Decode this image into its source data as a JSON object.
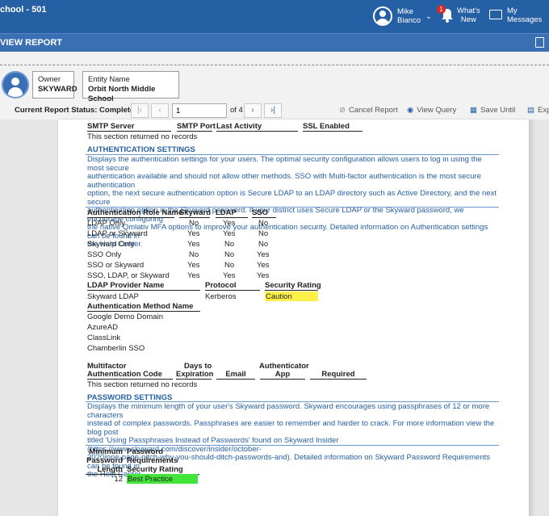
{
  "header": {
    "app_title": "chool - 501",
    "user_first": "Mike",
    "user_last": "Bianco",
    "notif_count": "1",
    "whats_new_1": "What's",
    "whats_new_2": "New",
    "my_messages_1": "My",
    "my_messages_2": "Messages",
    "subbar_title": "VIEW REPORT"
  },
  "owner": {
    "label": "Owner",
    "value": "SKYWARD"
  },
  "entity": {
    "label": "Entity Name",
    "value": "Orbit North Middle School"
  },
  "status": {
    "text": "Current Report Status: Completed",
    "page_value": "1",
    "of_label": "of 4",
    "cancel": "Cancel Report",
    "view_query": "View Query",
    "save_until": "Save Until",
    "export": "Exp"
  },
  "smtp": {
    "cols": [
      "SMTP Server",
      "SMTP Port",
      "Last Activity",
      "SSL Enabled"
    ],
    "empty": "This section returned no records"
  },
  "auth": {
    "title": "AUTHENTICATION SETTINGS",
    "desc": [
      "Displays the authentication settings for your users. The optimal security configuration allows users to log in using the most secure",
      "authentication available and should not allow other methods. SSO with Multi-factor authentication is the most secure authentication",
      "option, the next secure authentication option is Secure LDAP to an LDAP directory such as Active Directory, and the next secure",
      "authentication option is the Skyward password. If your district uses Secure LDAP or the Skyward password, we encourage configuring",
      "the native Qmlativ MFA options to improve your authentication security. Detailed information on Authentication settings can be found in",
      "the Help Center."
    ],
    "role_cols": [
      "Authentication Role Name",
      "Skyward",
      "LDAP",
      "SSO"
    ],
    "roles": [
      [
        "LDAP Only",
        "No",
        "Yes",
        "No"
      ],
      [
        "LDAP or Skyward",
        "Yes",
        "Yes",
        "No"
      ],
      [
        "Skyward Only",
        "Yes",
        "No",
        "No"
      ],
      [
        "SSO Only",
        "No",
        "No",
        "Yes"
      ],
      [
        "SSO or Skyward",
        "Yes",
        "No",
        "Yes"
      ],
      [
        "SSO, LDAP, or Skyward",
        "Yes",
        "Yes",
        "Yes"
      ]
    ],
    "ldap_cols": [
      "LDAP Provider Name",
      "Protocol",
      "Security Rating"
    ],
    "ldap_row": [
      "Skyward LDAP",
      "Kerberos",
      "Caution"
    ],
    "method_col": "Authentication Method Name",
    "methods": [
      "Google Demo Domain",
      "AzureAD",
      "ClassLink",
      "Chamberlin SSO"
    ]
  },
  "mfa": {
    "cols": [
      "Multifactor",
      "Authentication Code",
      "Days to",
      "Expiration",
      "Email",
      "Authenticator",
      "App",
      "Required"
    ],
    "empty": "This section returned no records"
  },
  "password": {
    "title": "PASSWORD SETTINGS",
    "desc": [
      "Displays the minimum length of your user's Skyward password. Skyward encourages using passphrases of 12 or more characters",
      "instead of complex passwords. Passphrases are easier to remember and harder to crack. For more information view the blog post",
      "titled 'Using Passphrases Instead of Passwords' found on Skyward Insider (https://www.skyward.com/discover/insider/october-",
      "2020/one-page-pitch-why-you-should-ditch-passwords-and). Detailed information on Skyward Password Requirements can be found in",
      "the Help Center."
    ],
    "col1": [
      "Minimum",
      "Password",
      "Length"
    ],
    "col2": [
      "Password",
      "Requirements",
      "Security Rating"
    ],
    "min_length": "12",
    "rating": "Best Practice"
  },
  "colors": {
    "header_blue": "#2660a4",
    "caution": "#fff14a",
    "best_practice": "#43e43a"
  }
}
